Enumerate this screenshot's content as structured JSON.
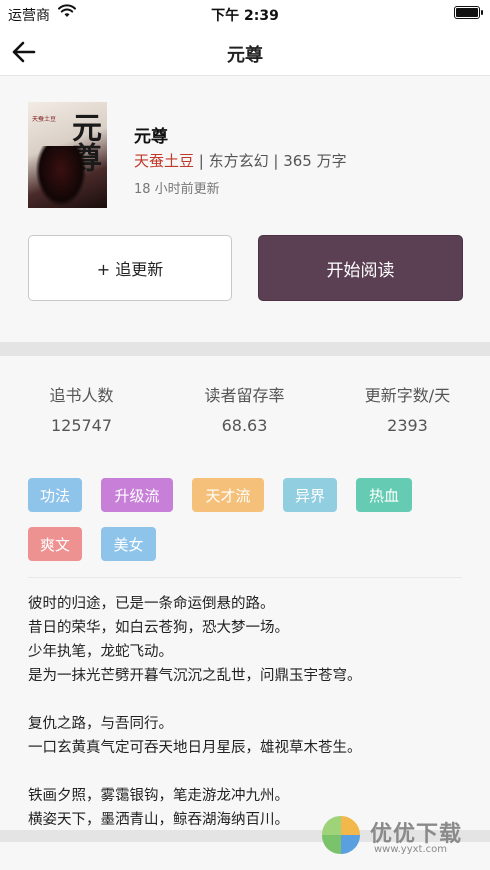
{
  "status_bar": {
    "carrier": "运营商",
    "time": "下午 2:39"
  },
  "nav": {
    "title": "元尊"
  },
  "book": {
    "cover_title": "元尊",
    "cover_author": "天蚕土豆",
    "name": "元尊",
    "author": "天蚕土豆",
    "sep1": " | ",
    "genre": "东方玄幻",
    "sep2": " | ",
    "word_count": "365 万字",
    "updated": "18 小时前更新"
  },
  "buttons": {
    "follow": "+ 追更新",
    "read": "开始阅读"
  },
  "stats": [
    {
      "label": "追书人数",
      "value": "125747"
    },
    {
      "label": "读者留存率",
      "value": "68.63"
    },
    {
      "label": "更新字数/天",
      "value": "2393"
    }
  ],
  "tags": [
    {
      "label": "功法",
      "color": "#8ec3ea"
    },
    {
      "label": "升级流",
      "color": "#c77fd8"
    },
    {
      "label": "天才流",
      "color": "#f5c07a"
    },
    {
      "label": "异界",
      "color": "#91cfe0"
    },
    {
      "label": "热血",
      "color": "#66cbb3"
    },
    {
      "label": "爽文",
      "color": "#ee9191"
    },
    {
      "label": "美女",
      "color": "#8ec3ea"
    }
  ],
  "synopsis": [
    "彼时的归途，已是一条命运倒悬的路。",
    "昔日的荣华，如白云苍狗，恐大梦一场。",
    "少年执笔，龙蛇飞动。",
    "是为一抹光芒劈开暮气沉沉之乱世，问鼎玉宇苍穹。",
    "",
    "复仇之路，与吾同行。",
    "一口玄黄真气定可吞天地日月星辰，雄视草木苍生。",
    "",
    "铁画夕照，雾霭银钩，笔走游龙冲九州。",
    "横姿天下，墨洒青山，鲸吞湖海纳百川。"
  ],
  "watermark": {
    "text": "优优下载",
    "url": "www.yyxt.com"
  }
}
